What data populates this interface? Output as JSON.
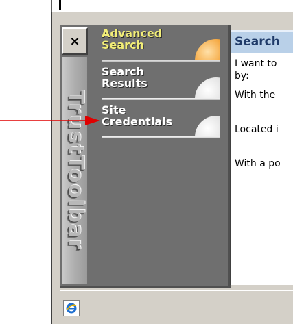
{
  "toolbar": {
    "close_label": "×",
    "brand": "TrustToolbar",
    "nav": [
      {
        "label": "Advanced Search",
        "active": true
      },
      {
        "label": "Search Results",
        "active": false
      },
      {
        "label": "Site Credentials",
        "active": false
      }
    ]
  },
  "panel": {
    "title": "Search",
    "intro_line1": "I want to",
    "intro_line2": "by:",
    "criteria": [
      "With the",
      "Located i",
      "With a po"
    ]
  },
  "colors": {
    "toolbar_bg": "#6f6f6f",
    "active_label": "#f2ee78",
    "active_orb": "#f4a43a",
    "panel_header": "#b9d0e8",
    "arrow": "#e00000"
  },
  "icons": {
    "close": "close-icon",
    "arrow": "red-arrow-icon",
    "browser": "ie-page-icon"
  }
}
